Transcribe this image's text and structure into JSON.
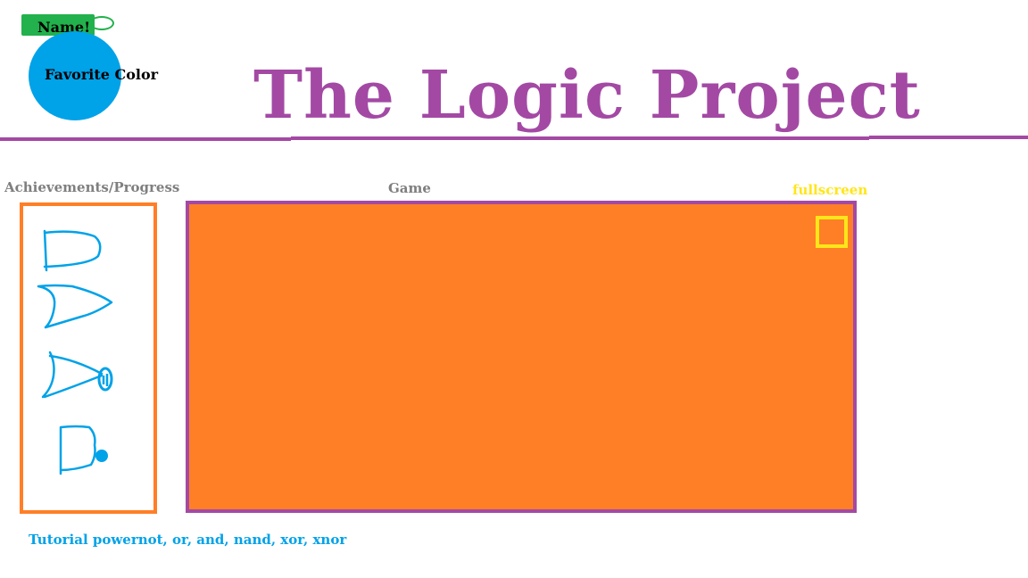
{
  "profile": {
    "name_label": "Name!",
    "favorite_color_label": "Favorite Color",
    "avatar_color": "#00a2e8",
    "name_tag_color": "#22b14c"
  },
  "header": {
    "title": "The Logic Project",
    "title_color": "#a349a4"
  },
  "achievements": {
    "label": "Achievements/Progress",
    "border_color": "#ff7f27",
    "icons": [
      "and-gate-icon",
      "or-gate-icon",
      "nand-gate-icon",
      "nand-gate-icon"
    ]
  },
  "game": {
    "label": "Game",
    "fullscreen_label": "fullscreen",
    "background_color": "#ff7f27",
    "border_color": "#a349a4",
    "fullscreen_color": "#ffe619"
  },
  "tutorial": {
    "text": "Tutorial powernot, or, and, nand, xor, xnor",
    "color": "#00a2e8"
  }
}
